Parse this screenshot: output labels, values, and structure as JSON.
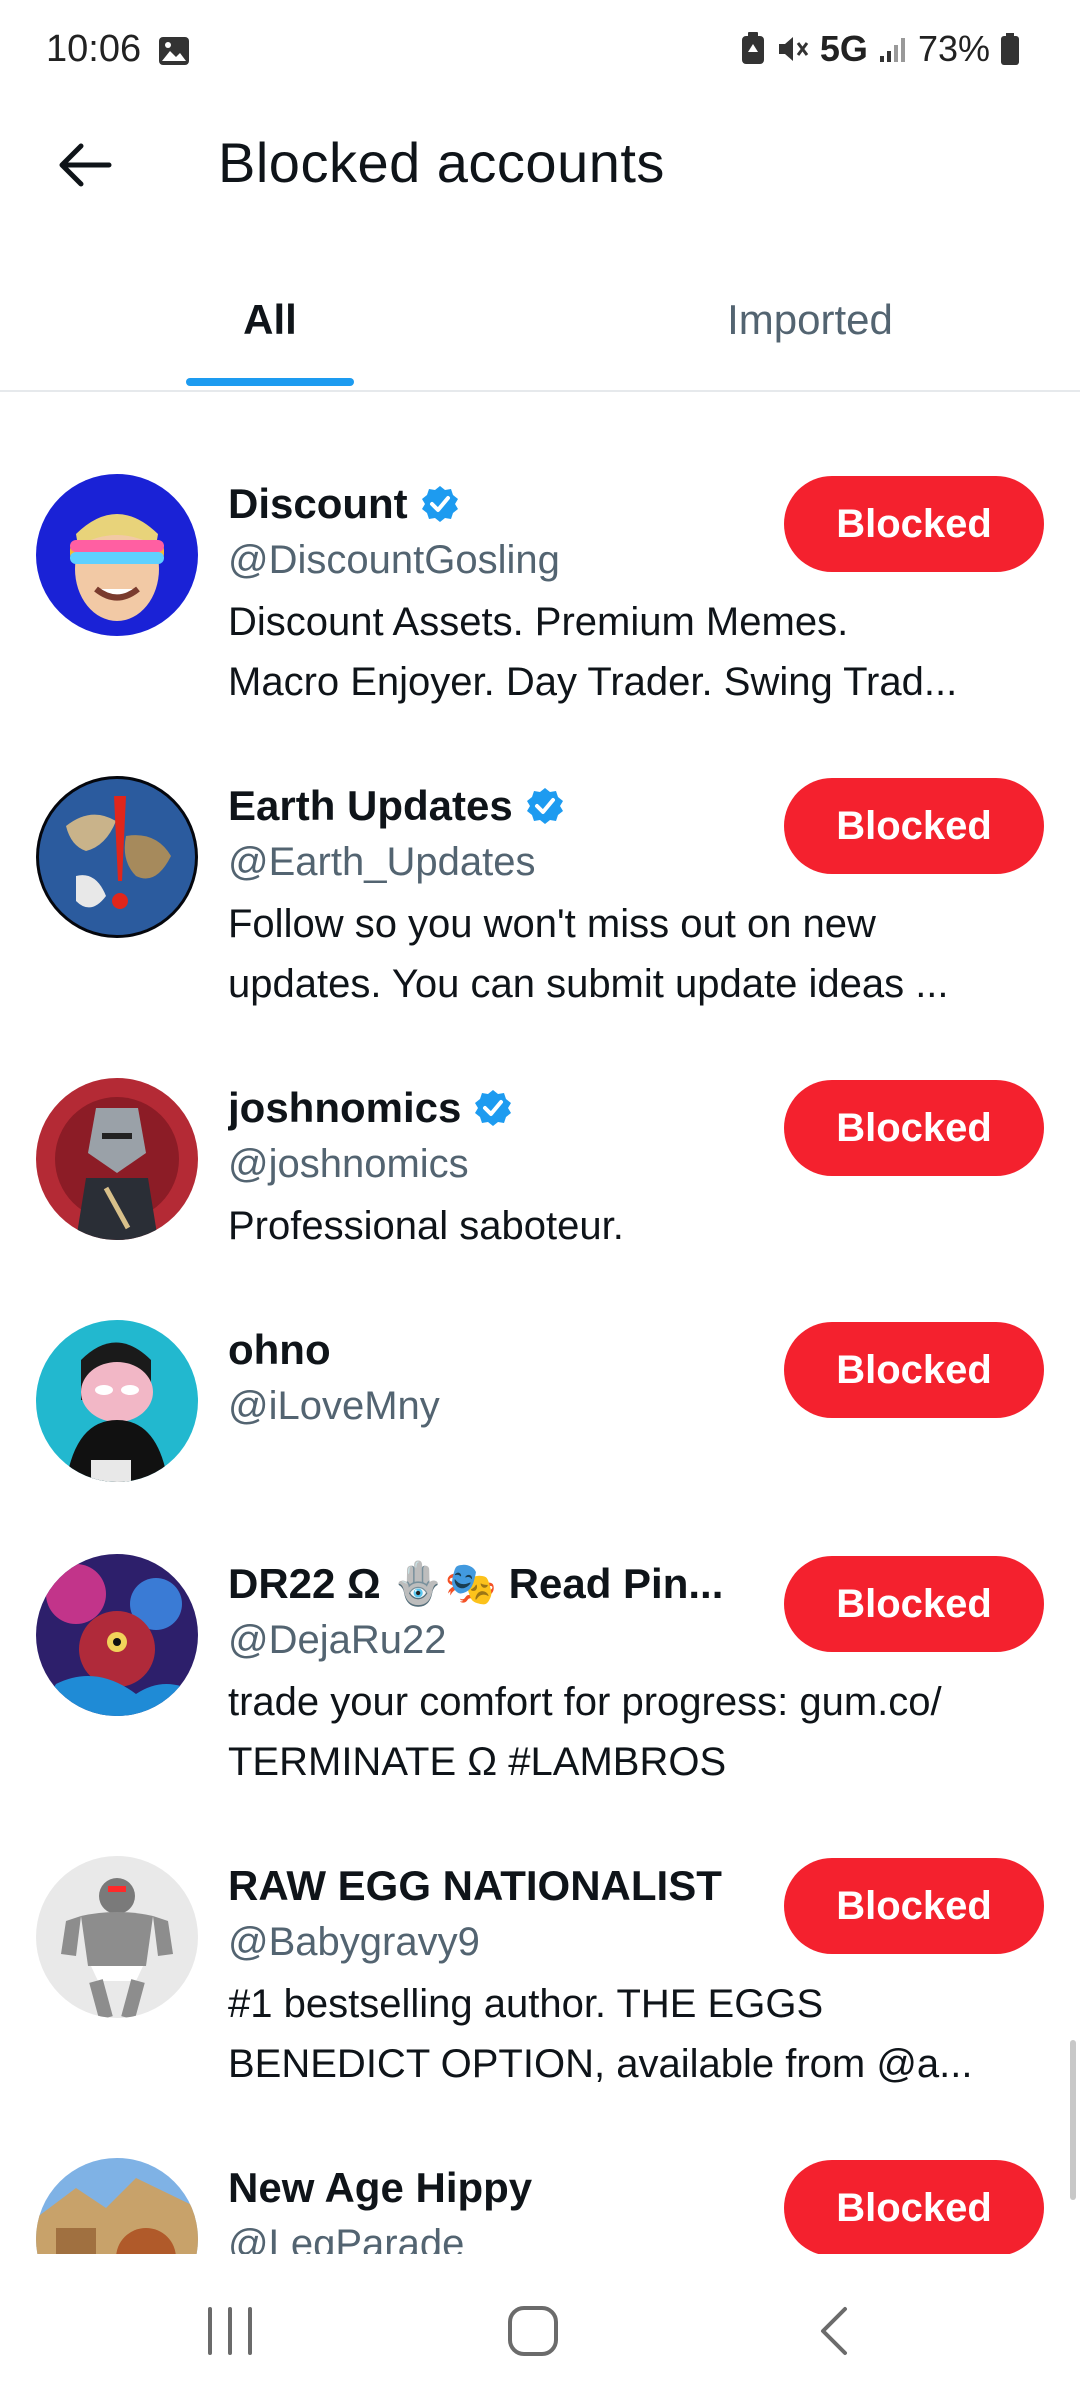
{
  "status_bar": {
    "time": "10:06",
    "network": "5G",
    "battery": "73%",
    "icons": [
      "image-icon",
      "battery-saver-icon",
      "mute-icon",
      "signal-icon",
      "battery-icon"
    ]
  },
  "header": {
    "back_icon": "arrow-left-icon",
    "title": "Blocked accounts"
  },
  "tabs": [
    {
      "label": "All",
      "selected": true
    },
    {
      "label": "Imported",
      "selected": false
    }
  ],
  "accent_color": "#1d9bf0",
  "blocked_color": "#f4212e",
  "accounts": [
    {
      "name": "Discount",
      "verified": true,
      "handle": "@DiscountGosling",
      "bio": [
        "Discount Assets. Premium Memes.",
        "Macro Enjoyer. Day Trader. Swing Trad..."
      ],
      "button": "Blocked"
    },
    {
      "name": "Earth Updates",
      "verified": true,
      "handle": "@Earth_Updates",
      "bio": [
        "Follow so you won't miss out on new",
        "updates. You can submit update ideas ..."
      ],
      "button": "Blocked"
    },
    {
      "name": "joshnomics",
      "verified": true,
      "handle": "@joshnomics",
      "bio": [
        "Professional saboteur."
      ],
      "button": "Blocked"
    },
    {
      "name": "ohno",
      "verified": false,
      "handle": "@iLoveMny",
      "bio": [],
      "button": "Blocked"
    },
    {
      "name": "DR22 Ω 🪬🎭 Read Pin...",
      "verified": false,
      "handle": "@DejaRu22",
      "bio": [
        "trade your comfort for progress: gum.co/",
        "TERMINATE  Ω  #LAMBROS"
      ],
      "button": "Blocked"
    },
    {
      "name": "RAW EGG NATIONALIST",
      "verified": false,
      "handle": "@Babygravy9",
      "bio": [
        "#1 bestselling author. THE EGGS",
        "BENEDICT OPTION, available from @a..."
      ],
      "button": "Blocked"
    },
    {
      "name": "New Age Hippy",
      "verified": false,
      "handle": "@LegParade",
      "bio": [],
      "button": "Blocked"
    }
  ],
  "nav_bar": {
    "icons": [
      "recents-icon",
      "home-icon",
      "back-icon"
    ]
  }
}
